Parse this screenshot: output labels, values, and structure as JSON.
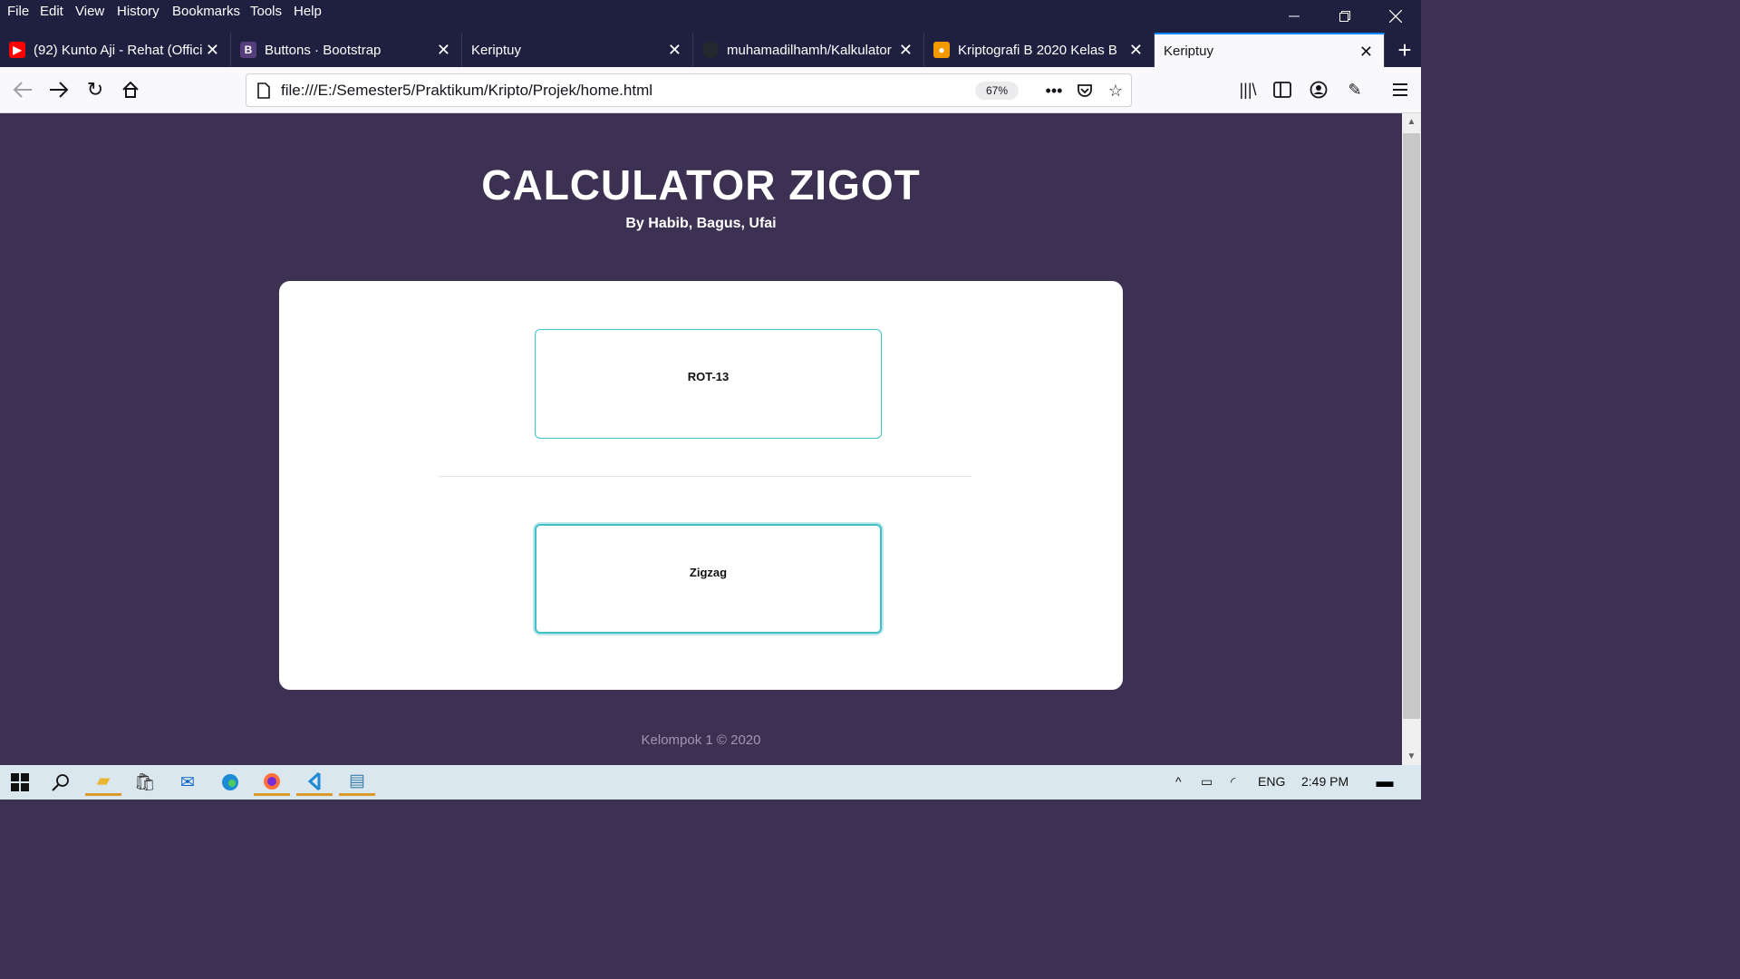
{
  "menubar": {
    "items": [
      "File",
      "Edit",
      "View",
      "History",
      "Bookmarks",
      "Tools",
      "Help"
    ]
  },
  "tabs": [
    {
      "title": "(92) Kunto Aji - Rehat (Official",
      "favicon": "youtube-icon",
      "color": "#ff0000"
    },
    {
      "title": "Buttons · Bootstrap",
      "favicon": "bootstrap-icon",
      "color": "#563d7c"
    },
    {
      "title": "Keriptuy",
      "favicon": "",
      "color": ""
    },
    {
      "title": "muhamadilhamh/Kalkulator",
      "favicon": "github-icon",
      "color": "#24292e"
    },
    {
      "title": "Kriptografi B 2020 Kelas B",
      "favicon": "classroom-icon",
      "color": "#f29900"
    },
    {
      "title": "Keriptuy",
      "favicon": "",
      "color": "",
      "active": true
    }
  ],
  "navbar": {
    "url": "file:///E:/Semester5/Praktikum/Kripto/Projek/home.html",
    "zoom": "67%"
  },
  "page": {
    "title": "CALCULATOR ZIGOT",
    "subtitle": "By Habib, Bagus, Ufai",
    "buttons": [
      "ROT-13",
      "Zigzag"
    ],
    "footer": "Kelompok 1 © 2020",
    "accent": "#3fc1c9",
    "background": "#3c3153"
  },
  "taskbar": {
    "language": "ENG",
    "time": "2:49 PM"
  }
}
